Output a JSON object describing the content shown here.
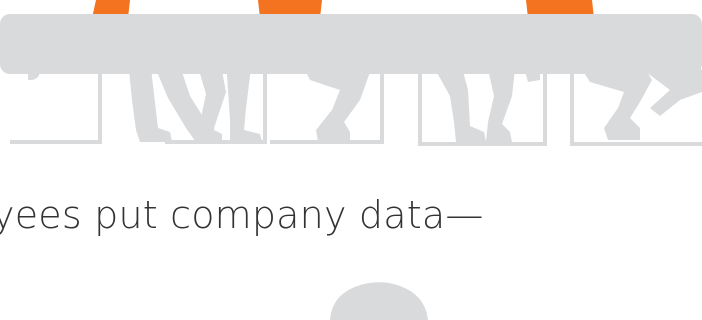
{
  "headline": {
    "text": "yees put company data—"
  },
  "colors": {
    "silhouette": "#d9dadb",
    "accent_orange": "#f47321",
    "headline_text": "#333333",
    "background": "#ffffff"
  }
}
